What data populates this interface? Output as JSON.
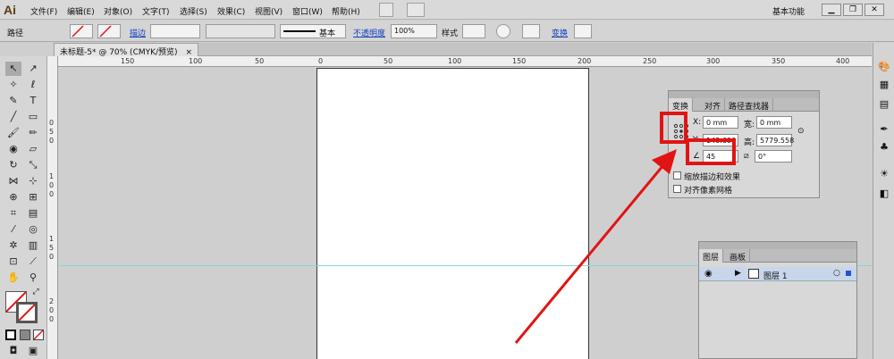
{
  "app": {
    "logo": "Ai",
    "workspace": "基本功能"
  },
  "menu": [
    "文件(F)",
    "编辑(E)",
    "对象(O)",
    "文字(T)",
    "选择(S)",
    "效果(C)",
    "视图(V)",
    "窗口(W)",
    "帮助(H)"
  ],
  "window_controls": {
    "minimize": "▁",
    "restore": "❐",
    "close": "✕"
  },
  "control": {
    "type_label": "路径",
    "stroke_link": "描边",
    "stroke_style": "基本",
    "opacity_link": "不透明度",
    "opacity_value": "100%",
    "style_label": "样式",
    "transform_link": "变换"
  },
  "document": {
    "tab": "未标题-5* @ 70% (CMYK/预览)",
    "close": "×"
  },
  "ruler": {
    "h_labels": [
      "150",
      "100",
      "50",
      "0",
      "50",
      "100",
      "150",
      "200",
      "250",
      "300",
      "350",
      "400"
    ],
    "v_labels": [
      "0",
      "5",
      "0",
      "1",
      "0",
      "0",
      "1",
      "5",
      "0",
      "2",
      "0",
      "0"
    ]
  },
  "transform_panel": {
    "tabs": [
      "变换",
      "对齐",
      "路径查找器"
    ],
    "x_label": "X:",
    "x_value": "0 mm",
    "w_label": "宽:",
    "w_value": "0 mm",
    "y_label": "Y:",
    "y_value": "148.696",
    "h_label": "高:",
    "h_value": "5779.558",
    "angle_value": "45",
    "shear_value": "0°",
    "scale_stroke": "缩放描边和效果",
    "align_pixel": "对齐像素网格"
  },
  "layers_panel": {
    "tabs": [
      "图层",
      "画板"
    ],
    "layer_name": "图层 1"
  },
  "colors": {
    "annotation": "#e11414",
    "guide": "#7fd8d8",
    "selection": "#c8d6ec"
  }
}
